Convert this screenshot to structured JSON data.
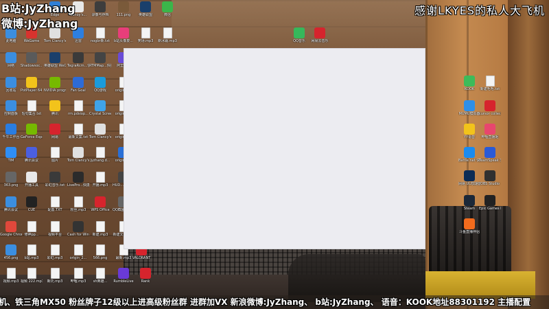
{
  "overlay": {
    "bilibili": "B站:JyZhang",
    "weibo": "微博:JyZhang",
    "thanks": "感谢LKYES的私人大飞机"
  },
  "ticker": {
    "text": "机、铁三角MX50  粉丝牌子12级以上进高级粉丝群  进群加VX  新浪微博:JyZhang、  b站:JyZhang、  语音：KOOK地址88301192  主播配置"
  },
  "desktop_icons": [
    {
      "label": "Edge",
      "color": "#2f7fd6"
    },
    {
      "label": "Canoy's...",
      "color": "#e8e8e8"
    },
    {
      "label": "录像与存档",
      "color": "#3d3d3d"
    },
    {
      "label": "111.png",
      "color": "#7a5a3a"
    },
    {
      "label": "英雄联盟",
      "color": "#1a3f6b"
    },
    {
      "label": "微信",
      "color": "#3bb54a"
    },
    {
      "label": "此电脑",
      "color": "#3b8ee0"
    },
    {
      "label": "WeGame",
      "color": "#d8332e"
    },
    {
      "label": "Tom Clancy's...",
      "color": "#e0e0e0"
    },
    {
      "label": "迅雷",
      "color": "#2d7fe0"
    },
    {
      "label": "nogbr新.txt",
      "color": "#f4f4f4"
    },
    {
      "label": "b站头像复...",
      "color": "#e83e7a"
    },
    {
      "label": "笑场.mp3",
      "color": "#f4f4f4"
    },
    {
      "label": "新冰霜.mp3",
      "color": "#f4f4f4"
    },
    {
      "label": "QQ音乐",
      "color": "#36b85b"
    },
    {
      "label": "网易云音乐",
      "color": "#d6242d"
    },
    {
      "label": "网络",
      "color": "#3b8ee0"
    },
    {
      "label": "Shadowsoc...快捷方式",
      "color": "#5a5a5a"
    },
    {
      "label": "英雄联盟 WeGame版",
      "color": "#1a3f6b"
    },
    {
      "label": "TegraRcm...快捷方式",
      "color": "#3a3a3a"
    },
    {
      "label": "RTMMap...快捷方式",
      "color": "#444"
    },
    {
      "label": "阿里云盘",
      "color": "#6a4bd6"
    },
    {
      "label": "回收站",
      "color": "#3b8ee0"
    },
    {
      "label": "PotPlayer 64 bit",
      "color": "#f2c31b"
    },
    {
      "label": "NVIDIA programs...",
      "color": "#76b900"
    },
    {
      "label": "Fan Goal",
      "color": "#2d6bd6"
    },
    {
      "label": "QQ游戏",
      "color": "#1a9bdc"
    },
    {
      "label": "origin_2...",
      "color": "#f4f4f4"
    },
    {
      "label": "控制面板",
      "color": "#3b8ee0"
    },
    {
      "label": "短句集合.txt",
      "color": "#f4f4f4"
    },
    {
      "label": "腾讯",
      "color": "#f2c31b"
    },
    {
      "label": "rm.pdsiop...",
      "color": "#f4f4f4"
    },
    {
      "label": "Crystal Screenshots",
      "color": "#3fa3e8"
    },
    {
      "label": "origin_2...",
      "color": "#f4f4f4"
    },
    {
      "label": "千牛工作台",
      "color": "#2a7de1"
    },
    {
      "label": "GeForce Experience",
      "color": "#76b900"
    },
    {
      "label": "网易",
      "color": "#d6242d"
    },
    {
      "label": "最新文案.txt",
      "color": "#f4f4f4"
    },
    {
      "label": "Tom Clancy's R...",
      "color": "#e0e0e0"
    },
    {
      "label": "origin_2...",
      "color": "#f4f4f4"
    },
    {
      "label": "TIM",
      "color": "#2f8ef5"
    },
    {
      "label": "腾讯会议",
      "color": "#4b5fe0"
    },
    {
      "label": "图片",
      "color": "#f4f4f4"
    },
    {
      "label": "Tom Clancy's R...",
      "color": "#e0e0e0"
    },
    {
      "label": "jyzhang.d...",
      "color": "#f4f4f4"
    },
    {
      "label": "origin_2...",
      "color": "#2a6fd6"
    },
    {
      "label": "363.png",
      "color": "#666"
    },
    {
      "label": "开播工具",
      "color": "#e8e8e8"
    },
    {
      "label": "彩虹音乐.txt",
      "color": "#3a3a3a"
    },
    {
      "label": "LivePro...快捷方式",
      "color": "#2b2b2b"
    },
    {
      "label": "开播.mp3",
      "color": "#f4f4f4"
    },
    {
      "label": "HUD...快捷方式",
      "color": "#444"
    },
    {
      "label": "腾讯会议",
      "color": "#3b8ee0"
    },
    {
      "label": "CUE",
      "color": "#222"
    },
    {
      "label": "配置.TXT",
      "color": "#f4f4f4"
    },
    {
      "label": "粉丝.mp3",
      "color": "#f4f4f4"
    },
    {
      "label": "WPS Office",
      "color": "#d6242d"
    },
    {
      "label": "QQ截图 2022...",
      "color": "#666"
    },
    {
      "label": "Google Chrome",
      "color": "#e0483b"
    },
    {
      "label": "修神pp...",
      "color": "#f4f4f4"
    },
    {
      "label": "视频平台",
      "color": "#f4f4f4"
    },
    {
      "label": "Cash for Windows...",
      "color": "#333"
    },
    {
      "label": "新建.mp3",
      "color": "#f4f4f4"
    },
    {
      "label": "新建文本 TXT",
      "color": "#f4f4f4"
    },
    {
      "label": "456.png",
      "color": "#3b8ee0"
    },
    {
      "label": "b站.mp3",
      "color": "#f4f4f4"
    },
    {
      "label": "彩虹.mp3",
      "color": "#f4f4f4"
    },
    {
      "label": "origin_2...",
      "color": "#f4f4f4"
    },
    {
      "label": "566.png",
      "color": "#f4f4f4"
    },
    {
      "label": "最新.mp3",
      "color": "#f4f4f4"
    },
    {
      "label": "VALORANT",
      "color": "#d6242d"
    },
    {
      "label": "视频.mp3",
      "color": "#f4f4f4"
    },
    {
      "label": "视频 222.mp3",
      "color": "#f4f4f4"
    },
    {
      "label": "新托.mp3",
      "color": "#f4f4f4"
    },
    {
      "label": "哔哩.mp3",
      "color": "#f4f4f4"
    },
    {
      "label": "sh英雄...",
      "color": "#f4f4f4"
    },
    {
      "label": "RumbleLive",
      "color": "#6a3ad6"
    },
    {
      "label": "Rank",
      "color": "#d6242d"
    },
    {
      "label": "KOOK",
      "color": "#3dbb5a"
    },
    {
      "label": "新建毛毛.txt",
      "color": "#f4f4f4"
    },
    {
      "label": "MUMU模拟器",
      "color": "#2e8fe8"
    },
    {
      "label": "cursor collect...",
      "color": "#d6242d"
    },
    {
      "label": "YY语音",
      "color": "#f2c31b"
    },
    {
      "label": "哔哩直播姬",
      "color": "#e8466e"
    },
    {
      "label": "Battle.net 快捷方式",
      "color": "#1a8bf0"
    },
    {
      "label": "TeamSpeak 3",
      "color": "#2a5ad6"
    },
    {
      "label": "网易 UU加速器",
      "color": "#0b2c55"
    },
    {
      "label": "OBS Studio",
      "color": "#303030"
    },
    {
      "label": "Steam",
      "color": "#1b2838"
    },
    {
      "label": "Epic Games Launcher",
      "color": "#222"
    },
    {
      "label": "斗鱼直播伴侣",
      "color": "#f26b1d"
    }
  ]
}
